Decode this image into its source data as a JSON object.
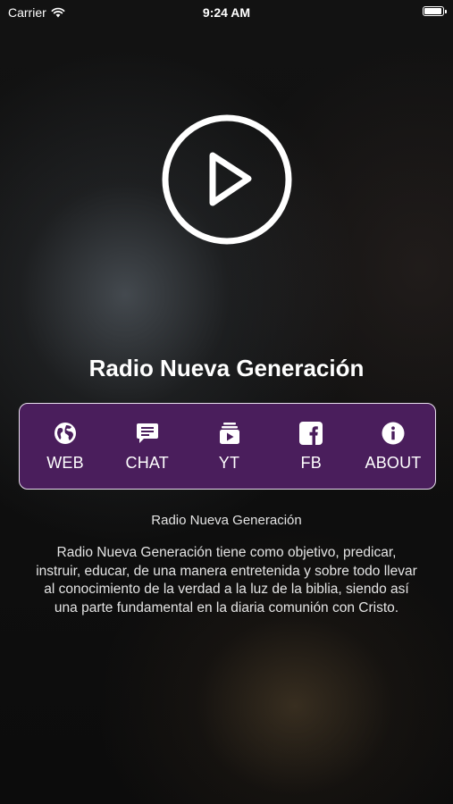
{
  "status_bar": {
    "carrier": "Carrier",
    "time": "9:24 AM",
    "battery_level": 1.0
  },
  "player": {
    "play_icon": "play-circle-icon",
    "station_title": "Radio Nueva Generación"
  },
  "nav": {
    "background_color": "#4a1e5c",
    "border_color": "#e9e1ee",
    "items": [
      {
        "label": "WEB",
        "icon": "globe-icon"
      },
      {
        "label": "CHAT",
        "icon": "chat-icon"
      },
      {
        "label": "YT",
        "icon": "youtube-icon"
      },
      {
        "label": "FB",
        "icon": "facebook-icon"
      },
      {
        "label": "ABOUT",
        "icon": "info-icon"
      }
    ]
  },
  "about": {
    "subtitle": "Radio Nueva Generación",
    "description": "Radio Nueva Generación tiene como objetivo, predicar, instruir, educar, de una manera entretenida y sobre todo llevar al conocimiento de la verdad a la luz de la biblia, siendo así una parte fundamental en la diaria comunión con Cristo."
  }
}
